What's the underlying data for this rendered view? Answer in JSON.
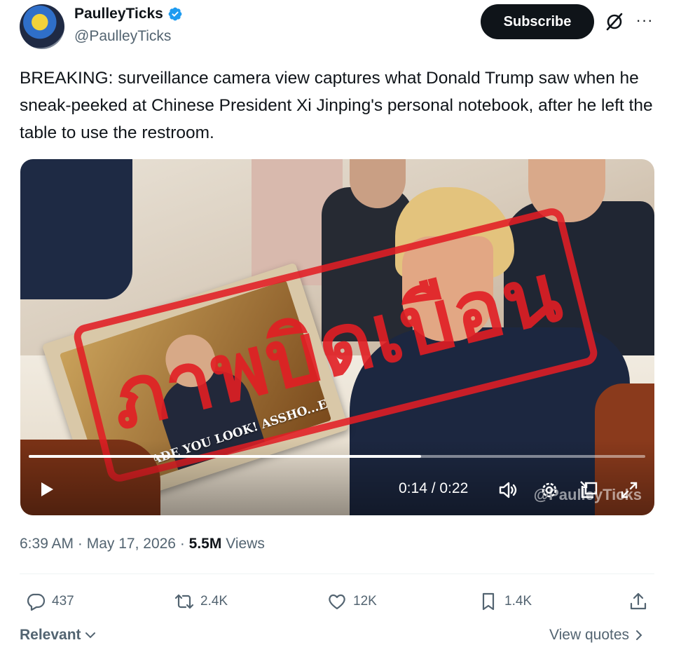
{
  "author": {
    "name": "PaulleyTicks",
    "handle": "@PaulleyTicks",
    "verified": true
  },
  "header": {
    "subscribe_label": "Subscribe",
    "grok_icon": "grok-icon",
    "more_icon": "more-icon",
    "more_label": "···"
  },
  "tweet": {
    "text": "BREAKING: surveillance camera view captures what Donald Trump saw when he sneak-peeked at Chinese President Xi Jinping's personal notebook, after he left the table to use the restroom."
  },
  "media": {
    "stamp_text": "ภาพบิดเบือน",
    "notebook_caption": "MADE YOU LOOK! ASSHO...E!",
    "watermark": "@PaulleyTicks",
    "current_time": "0:14",
    "duration": "0:22",
    "time_display": "0:14 / 0:22",
    "progress_fraction": 0.636
  },
  "meta": {
    "time": "6:39 AM",
    "date": "May 17, 2026",
    "views_count": "5.5M",
    "views_label": "Views"
  },
  "actions": {
    "replies": "437",
    "reposts": "2.4K",
    "likes": "12K",
    "bookmarks": "1.4K"
  },
  "footer": {
    "sort_label": "Relevant",
    "view_quotes_label": "View quotes"
  },
  "colors": {
    "accent": "#1d9bf0",
    "text_primary": "#0f1419",
    "text_secondary": "#536471",
    "stamp_red": "#e11e24"
  }
}
